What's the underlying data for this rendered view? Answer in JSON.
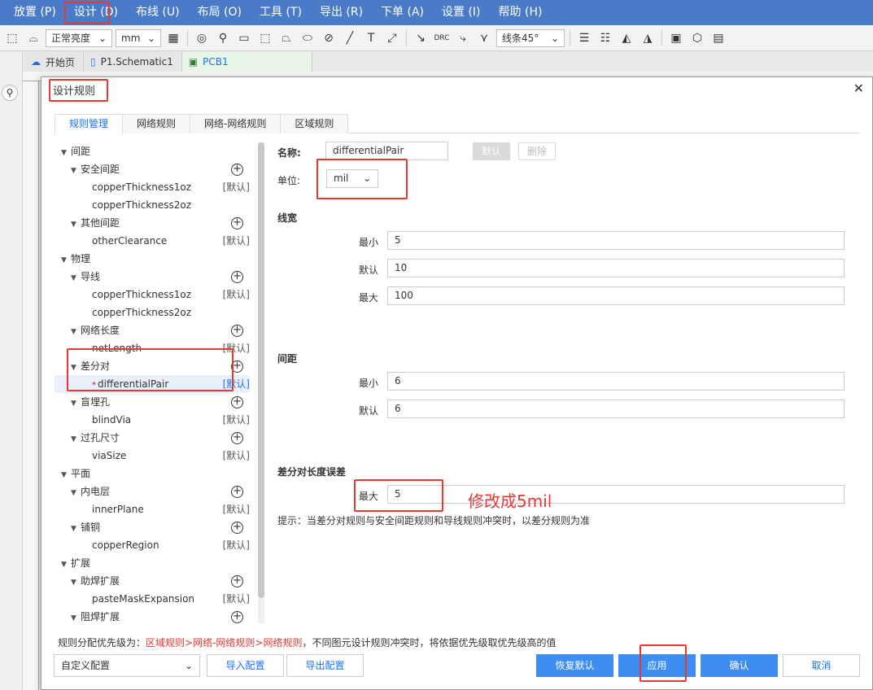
{
  "menu": [
    "放置 (P)",
    "设计 (D)",
    "布线 (U)",
    "布局 (O)",
    "工具 (T)",
    "导出 (R)",
    "下单 (A)",
    "设置 (I)",
    "帮助 (H)"
  ],
  "toolbar": {
    "brightness": "正常亮度",
    "unit": "mm",
    "route_mode": "线条45°"
  },
  "doc_tabs": [
    {
      "label": "开始页",
      "icon": "cloud-icon"
    },
    {
      "label": "P1.Schematic1",
      "icon": "document-icon"
    },
    {
      "label": "PCB1",
      "icon": "pcb-icon"
    }
  ],
  "dialog": {
    "title": "设计规则",
    "tabs": [
      "规则管理",
      "网络规则",
      "网络-网络规则",
      "区域规则"
    ],
    "tree": [
      {
        "label": "间距",
        "level": 0,
        "type": "group"
      },
      {
        "label": "安全间距",
        "level": 1,
        "type": "category"
      },
      {
        "label": "copperThickness1oz",
        "level": 2,
        "tag": "[默认]"
      },
      {
        "label": "copperThickness2oz",
        "level": 2,
        "tag": ""
      },
      {
        "label": "其他间距",
        "level": 1,
        "type": "category"
      },
      {
        "label": "otherClearance",
        "level": 2,
        "tag": "[默认]"
      },
      {
        "label": "物理",
        "level": 0,
        "type": "group"
      },
      {
        "label": "导线",
        "level": 1,
        "type": "category"
      },
      {
        "label": "copperThickness1oz",
        "level": 2,
        "tag": "[默认]"
      },
      {
        "label": "copperThickness2oz",
        "level": 2,
        "tag": ""
      },
      {
        "label": "网络长度",
        "level": 1,
        "type": "category"
      },
      {
        "label": "netLength",
        "level": 2,
        "tag": "[默认]"
      },
      {
        "label": "差分对",
        "level": 1,
        "type": "category"
      },
      {
        "label": "differentialPair",
        "level": 2,
        "tag": "[默认]",
        "selected": true
      },
      {
        "label": "盲埋孔",
        "level": 1,
        "type": "category"
      },
      {
        "label": "blindVia",
        "level": 2,
        "tag": "[默认]"
      },
      {
        "label": "过孔尺寸",
        "level": 1,
        "type": "category"
      },
      {
        "label": "viaSize",
        "level": 2,
        "tag": "[默认]"
      },
      {
        "label": "平面",
        "level": 0,
        "type": "group"
      },
      {
        "label": "内电层",
        "level": 1,
        "type": "category"
      },
      {
        "label": "innerPlane",
        "level": 2,
        "tag": "[默认]"
      },
      {
        "label": "铺铜",
        "level": 1,
        "type": "category"
      },
      {
        "label": "copperRegion",
        "level": 2,
        "tag": "[默认]"
      },
      {
        "label": "扩展",
        "level": 0,
        "type": "group"
      },
      {
        "label": "助焊扩展",
        "level": 1,
        "type": "category"
      },
      {
        "label": "pasteMaskExpansion",
        "level": 2,
        "tag": "[默认]"
      },
      {
        "label": "阻焊扩展",
        "level": 1,
        "type": "category"
      }
    ],
    "form": {
      "name_label": "名称:",
      "name_value": "differentialPair",
      "default_btn": "默认",
      "delete_btn": "删除",
      "unit_label": "单位:",
      "unit_value": "mil",
      "width_section": "线宽",
      "width_min_label": "最小",
      "width_min": "5",
      "width_default_label": "默认",
      "width_default": "10",
      "width_max_label": "最大",
      "width_max": "100",
      "gap_section": "间距",
      "gap_min_label": "最小",
      "gap_min": "6",
      "gap_default_label": "默认",
      "gap_default": "6",
      "skew_section": "差分对长度误差",
      "skew_max_label": "最大",
      "skew_max": "5",
      "hint": "提示：当差分对规则与安全间距规则和导线规则冲突时，以差分规则为准"
    },
    "footer_note": {
      "prefix": "规则分配优先级为：",
      "priority": "区域规则>网络-网络规则>网络规则",
      "suffix": "，不同图元设计规则冲突时，将依据优先级取优先级高的值"
    },
    "config_select": "自定义配置",
    "buttons": {
      "import": "导入配置",
      "export": "导出配置",
      "restore": "恢复默认",
      "apply": "应用",
      "confirm": "确认",
      "cancel": "取消"
    }
  },
  "annotation": "修改成5mil",
  "colors": {
    "menubar": "#4a7bc8",
    "primary": "#3d8ef0",
    "annotation": "#e53935"
  }
}
